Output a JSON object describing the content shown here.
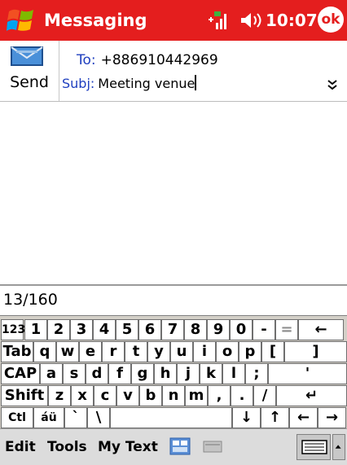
{
  "titlebar": {
    "app_title": "Messaging",
    "time": "10:07",
    "ok_label": "ok",
    "accent_color": "#e41e1e"
  },
  "header": {
    "send_label": "Send",
    "to_label": "To:",
    "to_value": "+886910442969",
    "subj_label": "Subj:",
    "subj_value": "Meeting venue"
  },
  "counter": "13/160",
  "keyboard": {
    "rows": [
      [
        "123",
        "1",
        "2",
        "3",
        "4",
        "5",
        "6",
        "7",
        "8",
        "9",
        "0",
        "-",
        "=",
        "←"
      ],
      [
        "Tab",
        "q",
        "w",
        "e",
        "r",
        "t",
        "y",
        "u",
        "i",
        "o",
        "p",
        "[",
        "]"
      ],
      [
        "CAP",
        "a",
        "s",
        "d",
        "f",
        "g",
        "h",
        "j",
        "k",
        "l",
        ";",
        "'"
      ],
      [
        "Shift",
        "z",
        "x",
        "c",
        "v",
        "b",
        "n",
        "m",
        ",",
        ".",
        "/",
        "↵"
      ],
      [
        "Ctl",
        "áü",
        "`",
        "\\",
        "",
        "↓",
        "↑",
        "←",
        "→"
      ]
    ]
  },
  "menubar": {
    "edit": "Edit",
    "tools": "Tools",
    "my_text": "My Text"
  },
  "icons": {
    "logo": "windows-flag-icon",
    "signal": "signal-icon",
    "volume": "speaker-icon",
    "send": "envelope-icon",
    "expand": "double-chevron-down-icon",
    "keyboard": "keyboard-icon"
  }
}
